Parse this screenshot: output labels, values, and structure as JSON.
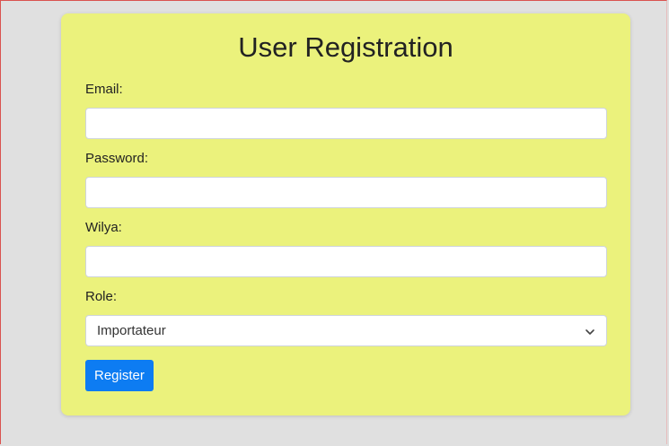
{
  "form": {
    "title": "User Registration",
    "email": {
      "label": "Email:",
      "value": "",
      "placeholder": ""
    },
    "password": {
      "label": "Password:",
      "value": "",
      "placeholder": ""
    },
    "wilya": {
      "label": "Wilya:",
      "value": "",
      "placeholder": ""
    },
    "role": {
      "label": "Role:",
      "selected": "Importateur"
    },
    "submit_label": "Register"
  },
  "colors": {
    "page_background": "#e0e0e0",
    "card_background": "#ebf27c",
    "button_primary": "#0d7cf2",
    "frame_border": "#d9534f"
  },
  "icons": {
    "role_dropdown": "chevron-down-icon"
  }
}
